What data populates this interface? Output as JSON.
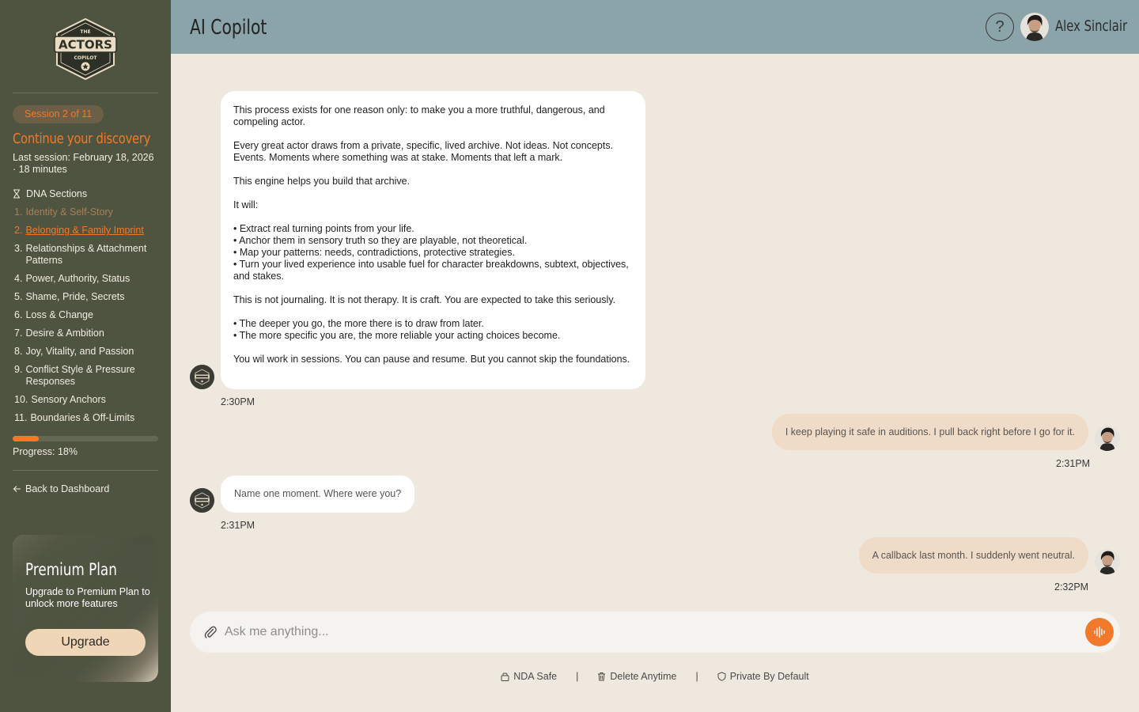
{
  "sidebar": {
    "logo": {
      "top": "THE",
      "main": "ACTORS",
      "sub": "COPILOT"
    },
    "session_badge": "Session 2 of 11",
    "discovery_title": "Continue your discovery",
    "last_session": "Last session: February 18, 2026 · 18 minutes",
    "dna_heading": "DNA Sections",
    "sections": [
      {
        "num": "1.",
        "label": "Identity & Self-Story",
        "state": "done"
      },
      {
        "num": "2.",
        "label": "Belonging & Family Imprint",
        "state": "active"
      },
      {
        "num": "3.",
        "label": "Relationships & Attachment Patterns",
        "state": "todo"
      },
      {
        "num": "4.",
        "label": "Power, Authority, Status",
        "state": "todo"
      },
      {
        "num": "5.",
        "label": "Shame, Pride, Secrets",
        "state": "todo"
      },
      {
        "num": "6.",
        "label": "Loss & Change",
        "state": "todo"
      },
      {
        "num": "7.",
        "label": "Desire & Ambition",
        "state": "todo"
      },
      {
        "num": "8.",
        "label": "Joy, Vitality, and Passion",
        "state": "todo"
      },
      {
        "num": "9.",
        "label": "Conflict Style & Pressure Responses",
        "state": "todo"
      },
      {
        "num": "10.",
        "label": "Sensory Anchors",
        "state": "todo"
      },
      {
        "num": "11.",
        "label": "Boundaries & Off-Limits",
        "state": "todo"
      }
    ],
    "progress_value": 0.18,
    "progress_label": "Progress: 18%",
    "back_label": "Back to Dashboard",
    "premium": {
      "title": "Premium Plan",
      "description": "Upgrade to Premium Plan to unlock more features",
      "button": "Upgrade"
    }
  },
  "header": {
    "title": "AI Copilot",
    "help": "?",
    "user_name": "Alex Sinclair"
  },
  "messages": {
    "m1": {
      "sender": "bot",
      "paragraphs": [
        "This process exists for one reason only: to make you a more truthful, dangerous,  and compeling actor.",
        "Every great actor draws from a private, specific, lived archive. Not ideas. Not  concepts. Events. Moments where something was at stake. Moments that left a  mark.",
        "This engine helps you build that archive.",
        "It will:",
        "• Extract real turning points from your life.\n• Anchor them in sensory truth so they are playable, not theoretical.\n• Map your patterns: needs, contradictions, protective strategies.\n• Turn your lived experience into usable fuel for character breakdowns, subtext, objectives, and stakes.",
        "This is not journaling. It is not therapy. It is craft.  You are expected to take this seriously.",
        "• The deeper you go, the more there is to draw from later.\n• The more specific you are, the more reliable your acting choices become.",
        "You wil work in sessions. You can pause and resume. But you cannot skip the foundations."
      ],
      "time": "2:30PM"
    },
    "m2": {
      "sender": "user",
      "text": "I keep playing it safe in auditions. I pull back right before I go for it.",
      "time": "2:31PM"
    },
    "m3": {
      "sender": "bot",
      "text": "Name one moment. Where were you?",
      "time": "2:31PM"
    },
    "m4": {
      "sender": "user",
      "text": "A callback last month. I suddenly went neutral.",
      "time": "2:32PM"
    }
  },
  "composer": {
    "placeholder": "Ask me anything..."
  },
  "footer": {
    "nda": "NDA Safe",
    "delete": "Delete Anytime",
    "private": "Private By Default",
    "divider": "|"
  },
  "colors": {
    "sidebar_bg": "#4f5441",
    "header_bg": "#8ba4a9",
    "page_bg": "#efe8de",
    "accent": "#f07a2a",
    "user_bubble": "#efdcc8"
  }
}
